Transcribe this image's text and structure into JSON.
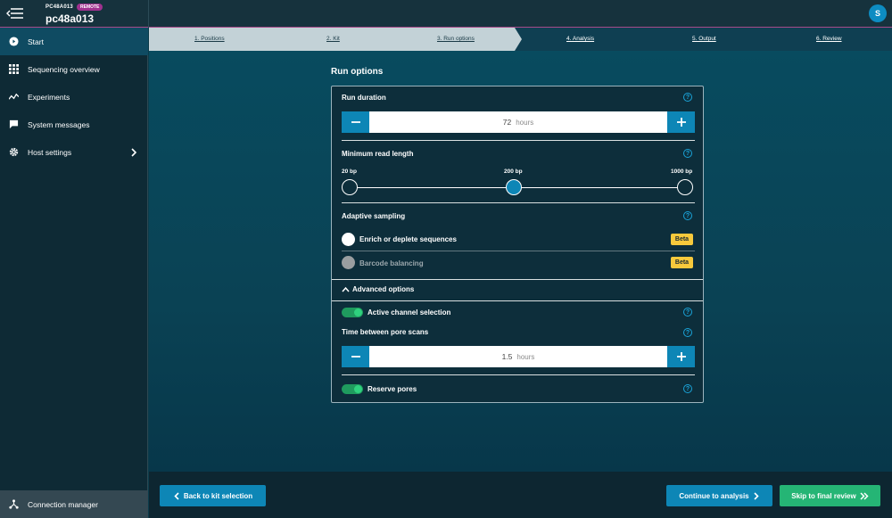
{
  "header": {
    "host_small": "PC48A013",
    "remote_badge": "REMOTE",
    "host_name": "pc48a013",
    "avatar_initial": "S"
  },
  "sidebar": {
    "items": [
      {
        "label": "Start",
        "icon": "play-circle-icon",
        "active": true
      },
      {
        "label": "Sequencing overview",
        "icon": "grid-icon"
      },
      {
        "label": "Experiments",
        "icon": "activity-icon"
      },
      {
        "label": "System messages",
        "icon": "message-icon"
      },
      {
        "label": "Host settings",
        "icon": "gear-icon"
      }
    ],
    "connection_manager": "Connection manager"
  },
  "stepper": {
    "steps": [
      "1. Positions",
      "2. Kit",
      "3. Run options",
      "4. Analysis",
      "5. Output",
      "6. Review"
    ],
    "current_step": 3
  },
  "page": {
    "title": "Run options"
  },
  "run_duration": {
    "label": "Run duration",
    "value": "72",
    "unit": "hours"
  },
  "min_read_length": {
    "label": "Minimum read length",
    "options": [
      "20 bp",
      "200 bp",
      "1000 bp"
    ],
    "selected": "200 bp"
  },
  "adaptive_sampling": {
    "label": "Adaptive sampling",
    "options": [
      {
        "label": "Enrich or deplete sequences",
        "badge": "Beta",
        "enabled": true
      },
      {
        "label": "Barcode balancing",
        "badge": "Beta",
        "enabled": false
      }
    ]
  },
  "advanced": {
    "toggle_label": "Advanced options",
    "active_channel_selection": {
      "label": "Active channel selection",
      "on": true
    },
    "pore_scan": {
      "label": "Time between pore scans",
      "value": "1.5",
      "unit": "hours"
    },
    "reserve_pores": {
      "label": "Reserve pores",
      "on": true
    }
  },
  "footer": {
    "back_label": "Back to kit selection",
    "continue_label": "Continue to analysis",
    "skip_label": "Skip to final review"
  },
  "colors": {
    "accent_blue": "#0d86b6",
    "accent_green": "#25b575",
    "beta_yellow": "#f7c93c",
    "remote_purple": "#a0318f"
  }
}
